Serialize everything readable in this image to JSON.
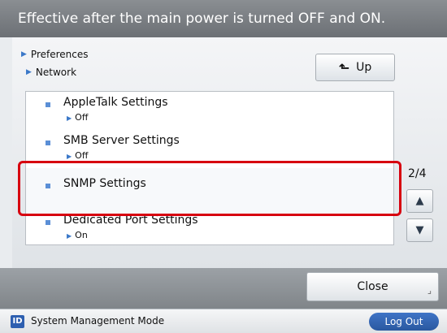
{
  "message_bar": {
    "text": "Effective after the main power is turned OFF and ON."
  },
  "breadcrumb": {
    "items": [
      "Preferences",
      "Network"
    ]
  },
  "up_button": {
    "label": "Up",
    "icon": "up-arrow-icon"
  },
  "list": {
    "items": [
      {
        "title": "AppleTalk Settings",
        "value": "Off"
      },
      {
        "title": "SMB Server Settings",
        "value": "Off"
      },
      {
        "title": "SNMP Settings",
        "value": ""
      },
      {
        "title": "Dedicated Port Settings",
        "value": "On"
      }
    ],
    "selected_index": 2
  },
  "pager": {
    "page": "2/4",
    "up_icon": "triangle-up-icon",
    "down_icon": "triangle-down-icon"
  },
  "close_button": {
    "label": "Close"
  },
  "status_bar": {
    "mode_text": "System Management Mode",
    "logout_label": "Log Out",
    "badge_text": "ID"
  },
  "colors": {
    "accent": "#2d5fb0",
    "highlight": "#d7000f",
    "bullet": "#5b8fd6"
  }
}
